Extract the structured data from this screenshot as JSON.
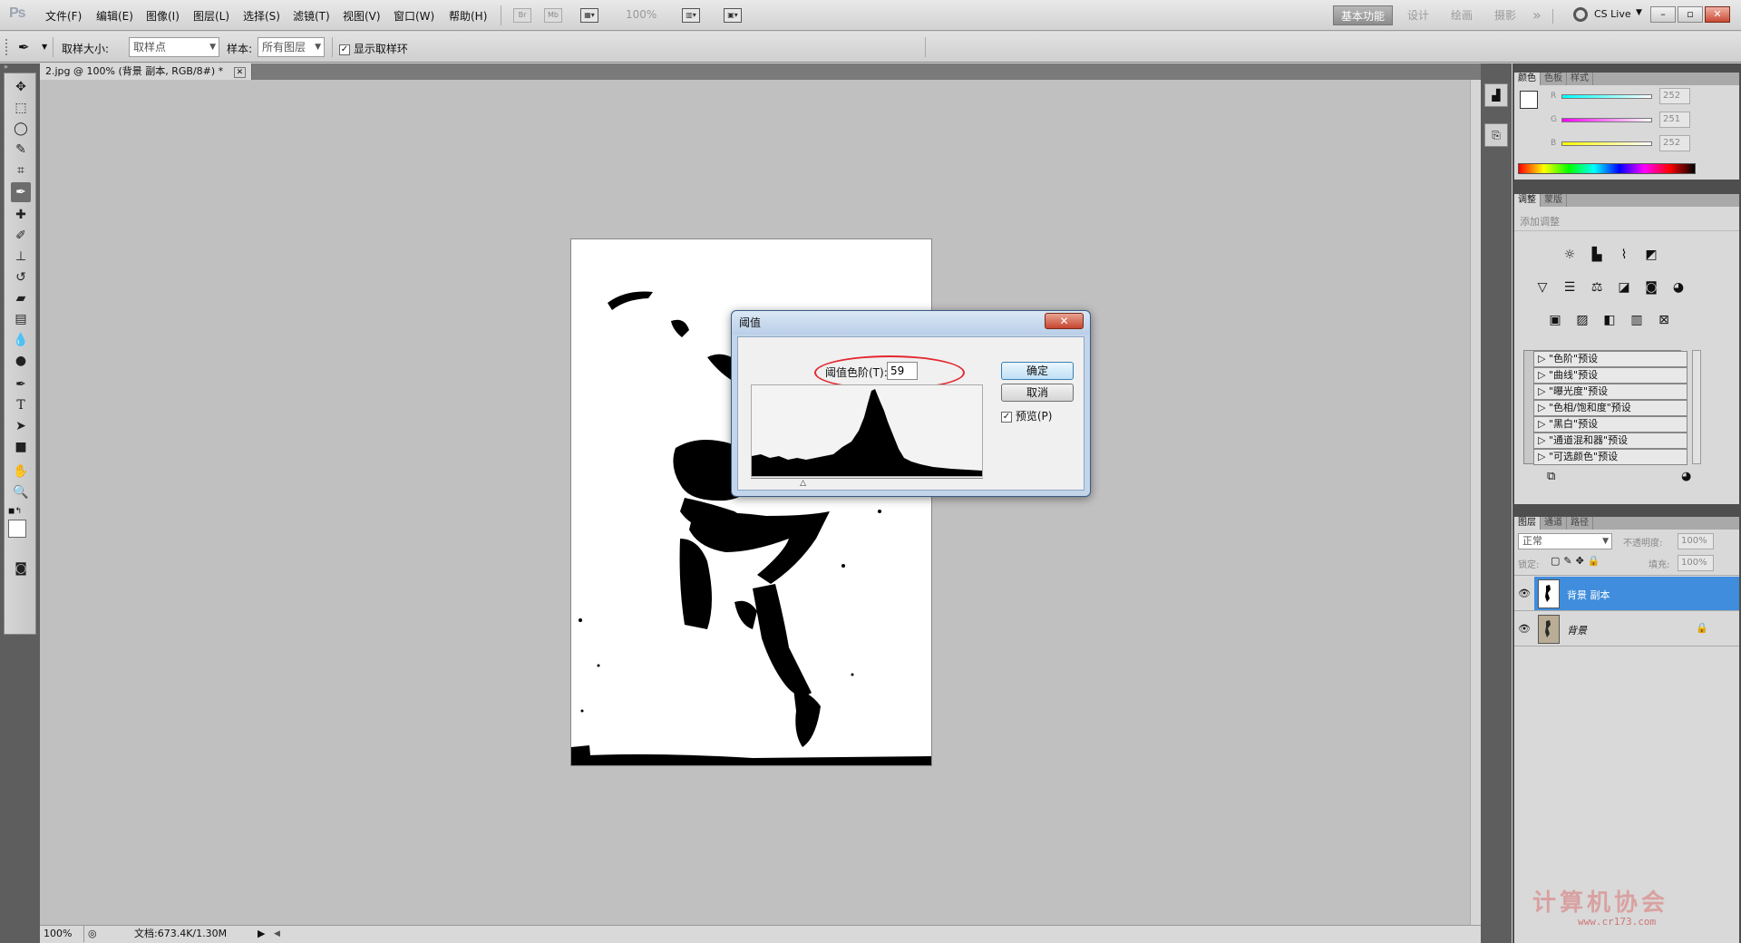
{
  "app": {
    "logo": "Ps",
    "menus": [
      "文件(F)",
      "编辑(E)",
      "图像(I)",
      "图层(L)",
      "选择(S)",
      "滤镜(T)",
      "视图(V)",
      "窗口(W)",
      "帮助(H)"
    ],
    "menubar_icons": [
      "Br",
      "Mb"
    ],
    "zoom": "100%",
    "workspaces": [
      "基本功能",
      "设计",
      "绘画",
      "摄影"
    ],
    "workspace_more": "»",
    "cs_live": "CS Live",
    "window_buttons": [
      "–",
      "▫",
      "✕"
    ]
  },
  "options": {
    "sample_size_label": "取样大小:",
    "sample_size_value": "取样点",
    "sample_label": "样本:",
    "sample_value": "所有图层",
    "show_ring_label": "显示取样环",
    "show_ring_checked": true
  },
  "document": {
    "tab_title": "2.jpg @ 100% (背景 副本, RGB/8#) *",
    "status_zoom": "100%",
    "status_doc": "文档:673.4K/1.30M"
  },
  "dialog": {
    "title": "阈值",
    "level_label": "阈值色阶(T):",
    "level_value": "59",
    "ok": "确定",
    "cancel": "取消",
    "preview_label": "预览(P)",
    "preview_checked": true,
    "slider_position": 0.231
  },
  "color_panel": {
    "tabs": [
      "颜色",
      "色板",
      "样式"
    ],
    "channels": [
      {
        "label": "R",
        "value": "252",
        "color_from": "#00ffff",
        "color_to": "#ffffff"
      },
      {
        "label": "G",
        "value": "251",
        "color_from": "#ff00ff",
        "color_to": "#ffffff"
      },
      {
        "label": "B",
        "value": "252",
        "color_from": "#ffff00",
        "color_to": "#ffffff"
      }
    ]
  },
  "adjust_panel": {
    "tabs": [
      "调整",
      "蒙版"
    ],
    "heading": "添加调整",
    "presets": [
      "\"色阶\"预设",
      "\"曲线\"预设",
      "\"曝光度\"预设",
      "\"色相/饱和度\"预设",
      "\"黑白\"预设",
      "\"通道混和器\"预设",
      "\"可选颜色\"预设"
    ]
  },
  "layers_panel": {
    "tabs": [
      "图层",
      "通道",
      "路径"
    ],
    "blend_mode": "正常",
    "opacity_label": "不透明度:",
    "opacity_value": "100%",
    "lock_label": "锁定:",
    "fill_label": "填充:",
    "fill_value": "100%",
    "layers": [
      {
        "name": "背景 副本",
        "selected": true,
        "locked": false
      },
      {
        "name": "背景",
        "selected": false,
        "locked": true
      }
    ]
  },
  "watermark": {
    "text": "计算机协会",
    "url": "www.cr173.com"
  }
}
